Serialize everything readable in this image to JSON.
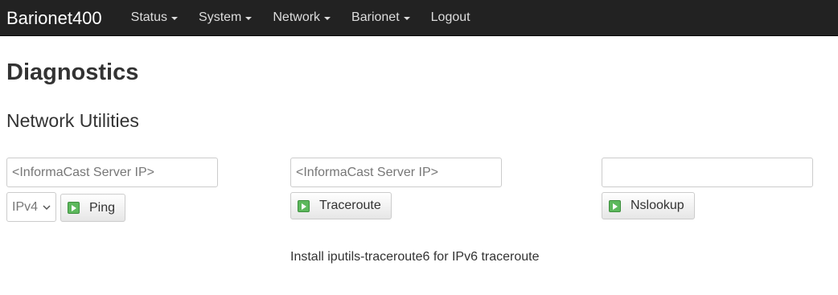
{
  "brand": "Barionet400",
  "nav": {
    "items": [
      {
        "label": "Status"
      },
      {
        "label": "System"
      },
      {
        "label": "Network"
      },
      {
        "label": "Barionet"
      },
      {
        "label": "Logout"
      }
    ]
  },
  "page": {
    "title": "Diagnostics",
    "section_title": "Network Utilities"
  },
  "ping": {
    "placeholder": "<InformaCast Server IP>",
    "value": "",
    "protocol_selected": "IPv4",
    "button_label": "Ping"
  },
  "traceroute": {
    "placeholder": "<InformaCast Server IP>",
    "value": "",
    "button_label": "Traceroute",
    "note": "Install iputils-traceroute6 for IPv6 traceroute"
  },
  "nslookup": {
    "placeholder": "",
    "value": "",
    "button_label": "Nslookup"
  },
  "colors": {
    "navbar_bg": "#222222",
    "button_icon_green": "#5cb85c"
  }
}
